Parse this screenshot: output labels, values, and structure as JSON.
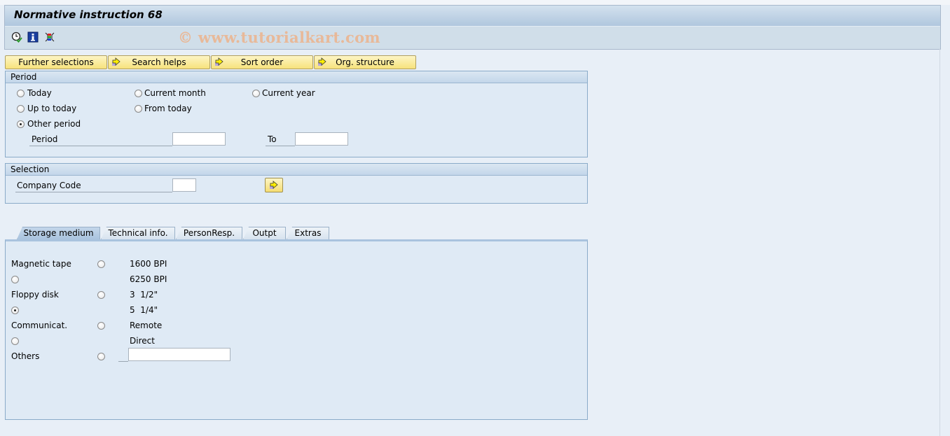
{
  "window": {
    "title": "Normative instruction 68",
    "watermark": "© www.tutorialkart.com"
  },
  "toolbar": {
    "icons": [
      {
        "name": "execute-clock-icon",
        "tooltip": "Execute"
      },
      {
        "name": "info-icon",
        "tooltip": "Information"
      },
      {
        "name": "selection-options-icon",
        "tooltip": "Selection options"
      }
    ]
  },
  "buttons": [
    {
      "label": "Further selections",
      "icon": null
    },
    {
      "label": "Search helps",
      "icon": "arrow-right-icon"
    },
    {
      "label": "Sort order",
      "icon": "arrow-right-icon"
    },
    {
      "label": "Org. structure",
      "icon": "arrow-right-icon"
    }
  ],
  "period": {
    "title": "Period",
    "options": [
      {
        "label": "Today",
        "checked": false
      },
      {
        "label": "Current month",
        "checked": false
      },
      {
        "label": "Current year",
        "checked": false
      },
      {
        "label": "Up to today",
        "checked": false
      },
      {
        "label": "From today",
        "checked": false
      },
      {
        "label": "Other period",
        "checked": true
      }
    ],
    "period_label": "Period",
    "period_from": "",
    "to_label": "To",
    "period_to": ""
  },
  "selection": {
    "title": "Selection",
    "company_code_label": "Company Code",
    "company_code_value": ""
  },
  "tabs": [
    {
      "label": "Storage medium",
      "active": true
    },
    {
      "label": "Technical info.",
      "active": false
    },
    {
      "label": "PersonResp.",
      "active": false
    },
    {
      "label": "Outpt",
      "active": false
    },
    {
      "label": "Extras",
      "active": false
    }
  ],
  "storage": {
    "magnetic_tape_label": "Magnetic tape",
    "floppy_disk_label": "Floppy disk",
    "communicat_label": "Communicat.",
    "others_label": "Others",
    "opt_1600": "1600 BPI",
    "opt_6250": "6250 BPI",
    "opt_3_5": "3  1/2\"",
    "opt_5_25": "5  1/4\"",
    "opt_remote": "Remote",
    "opt_direct": "Direct",
    "others_value": "",
    "selected": "5  1/4\""
  }
}
